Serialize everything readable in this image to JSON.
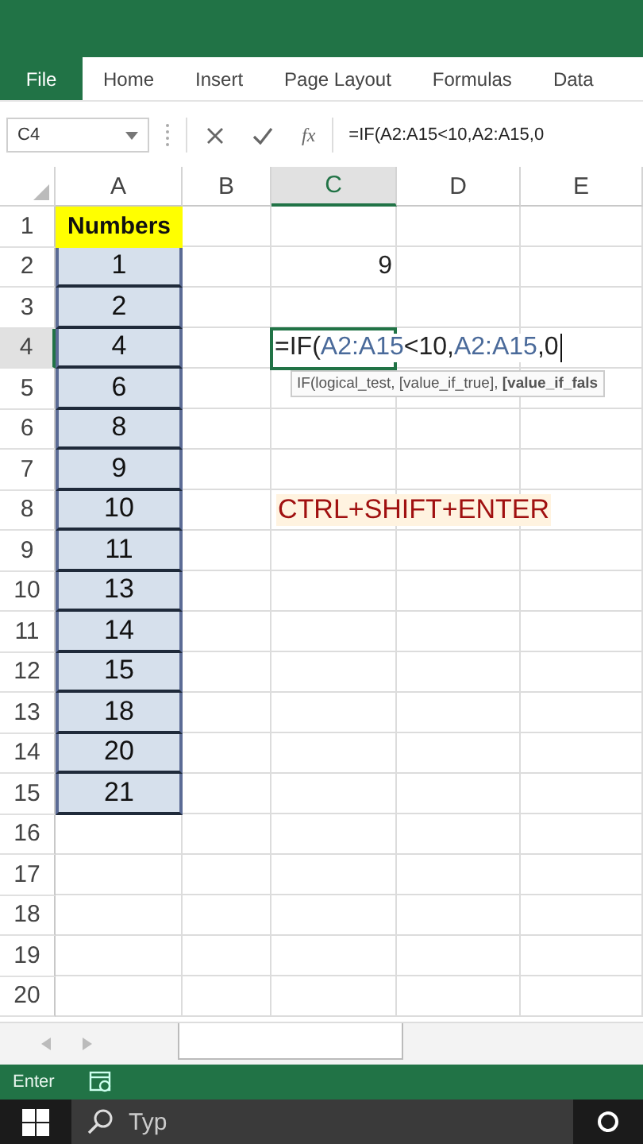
{
  "ribbon_tabs": [
    {
      "label": "File",
      "selected": true
    },
    {
      "label": "Home",
      "selected": false
    },
    {
      "label": "Insert",
      "selected": false
    },
    {
      "label": "Page Layout",
      "selected": false
    },
    {
      "label": "Formulas",
      "selected": false
    },
    {
      "label": "Data",
      "selected": false
    }
  ],
  "formula_bar": {
    "name_box": "C4",
    "function_label": "fx",
    "formula": "=IF(A2:A15<10,A2:A15,0"
  },
  "columns": [
    {
      "label": "A",
      "selected": false
    },
    {
      "label": "B",
      "selected": false
    },
    {
      "label": "C",
      "selected": true
    },
    {
      "label": "D",
      "selected": false
    },
    {
      "label": "E",
      "selected": false
    }
  ],
  "rows": [
    {
      "number": "1",
      "selected": false,
      "column_a": {
        "text": "Numbers",
        "kind": "heading",
        "selected": false
      }
    },
    {
      "number": "2",
      "selected": false,
      "column_a": {
        "text": "1",
        "kind": "value",
        "selected": true
      },
      "column_c": {
        "kind": "number",
        "text": "9"
      }
    },
    {
      "number": "3",
      "selected": false,
      "column_a": {
        "text": "2",
        "kind": "value",
        "selected": true
      }
    },
    {
      "number": "4",
      "selected": true,
      "column_a": {
        "text": "4",
        "kind": "value",
        "selected": true
      },
      "column_c": {
        "kind": "editing",
        "parts": [
          {
            "text": "=IF(",
            "kind": "plain"
          },
          {
            "text": "A2:A15",
            "kind": "ref"
          },
          {
            "text": "<10,",
            "kind": "plain"
          },
          {
            "text": "A2:A15",
            "kind": "ref"
          },
          {
            "text": ",0",
            "kind": "plain"
          }
        ]
      }
    },
    {
      "number": "5",
      "selected": false,
      "column_a": {
        "text": "6",
        "kind": "value",
        "selected": true
      },
      "column_c": {
        "kind": "tooltip",
        "text": "IF(logical_test, [value_if_true], **[value_if_fals**"
      }
    },
    {
      "number": "6",
      "selected": false,
      "column_a": {
        "text": "8",
        "kind": "value",
        "selected": true
      }
    },
    {
      "number": "7",
      "selected": false,
      "column_a": {
        "text": "9",
        "kind": "value",
        "selected": true
      }
    },
    {
      "number": "8",
      "selected": false,
      "column_a": {
        "text": "10",
        "kind": "value",
        "selected": true
      },
      "column_c": {
        "kind": "note",
        "text": "CTRL+SHIFT+ENTER"
      }
    },
    {
      "number": "9",
      "selected": false,
      "column_a": {
        "text": "11",
        "kind": "value",
        "selected": true
      }
    },
    {
      "number": "10",
      "selected": false,
      "column_a": {
        "text": "13",
        "kind": "value",
        "selected": true
      }
    },
    {
      "number": "11",
      "selected": false,
      "column_a": {
        "text": "14",
        "kind": "value",
        "selected": true
      }
    },
    {
      "number": "12",
      "selected": false,
      "column_a": {
        "text": "15",
        "kind": "value",
        "selected": true
      }
    },
    {
      "number": "13",
      "selected": false,
      "column_a": {
        "text": "18",
        "kind": "value",
        "selected": true
      }
    },
    {
      "number": "14",
      "selected": false,
      "column_a": {
        "text": "20",
        "kind": "value",
        "selected": true
      }
    },
    {
      "number": "15",
      "selected": false,
      "column_a": {
        "text": "21",
        "kind": "value",
        "selected": true
      }
    },
    {
      "number": "16",
      "selected": false
    },
    {
      "number": "17",
      "selected": false
    },
    {
      "number": "18",
      "selected": false
    },
    {
      "number": "19",
      "selected": false
    },
    {
      "number": "20",
      "selected": false
    }
  ],
  "status_bar": {
    "mode": "Enter"
  },
  "taskbar": {
    "search_placeholder": "Typ"
  }
}
